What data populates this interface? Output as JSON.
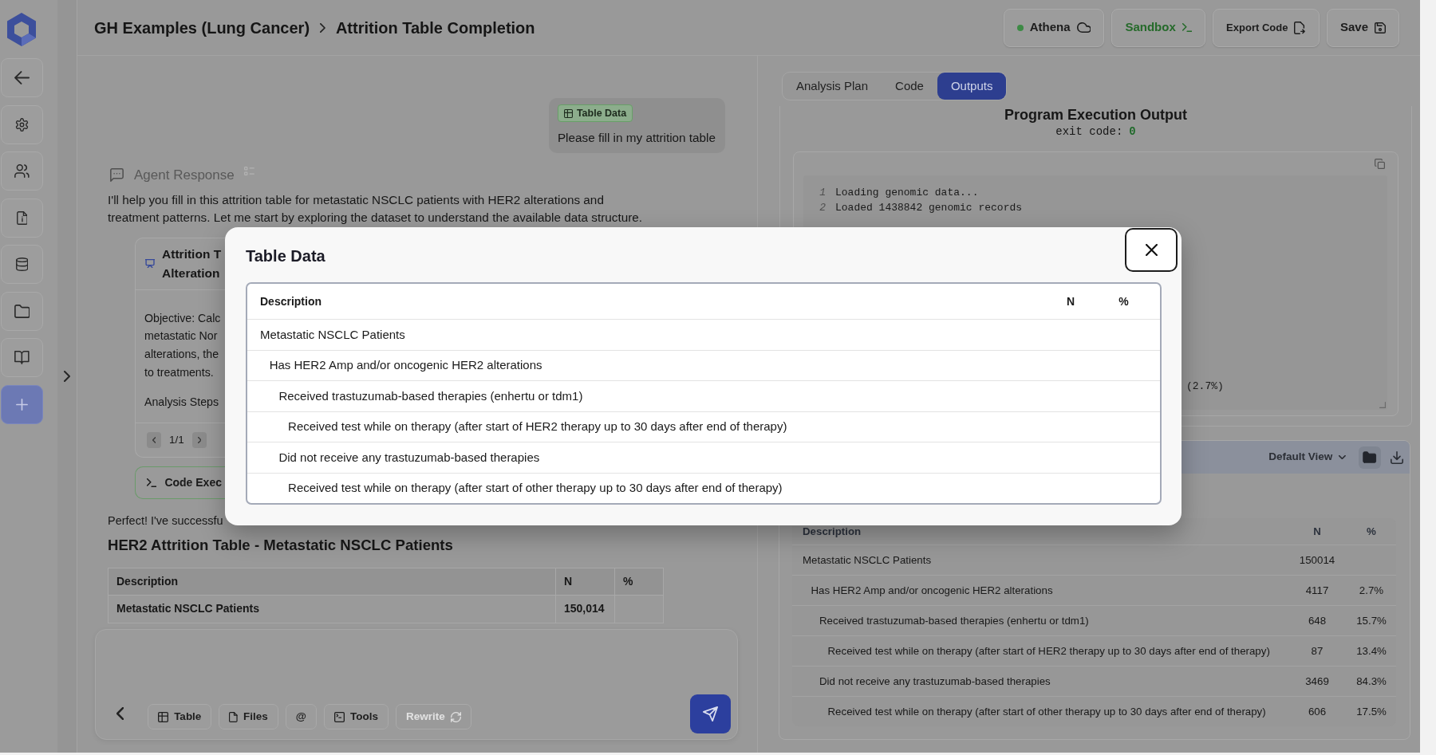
{
  "sidebar": {
    "items": [
      {
        "kind": "back"
      },
      {
        "kind": "settings"
      },
      {
        "kind": "users"
      },
      {
        "kind": "document"
      },
      {
        "kind": "database"
      },
      {
        "kind": "folder"
      },
      {
        "kind": "library"
      },
      {
        "kind": "new"
      }
    ]
  },
  "header": {
    "breadcrumb": [
      "GH Examples (Lung Cancer)",
      "Attrition Table Completion"
    ],
    "buttons": [
      {
        "kind": "environment",
        "label": "Athena"
      },
      {
        "kind": "sandbox",
        "label": "Sandbox"
      },
      {
        "kind": "export",
        "label": "Export Code"
      },
      {
        "kind": "save",
        "label": "Save"
      }
    ]
  },
  "chat": {
    "user_message": {
      "attachment": "Table Data",
      "text": "Please fill in my attrition table"
    },
    "agent_response": {
      "title": "Agent Response",
      "text": "I'll help you fill in this attrition table for metastatic NSCLC patients with HER2 alterations and treatment patterns. Let me start by exploring the dataset to understand the available data structure."
    },
    "plan_card": {
      "title_lines": [
        "Attrition T",
        "Alteration"
      ],
      "body_lines": [
        "Objective: Calc",
        "metastatic Nor",
        "alterations, the",
        "to treatments."
      ],
      "steps_label": "Analysis Steps",
      "pager": "1/1"
    },
    "code_card": {
      "title": "Code Exec"
    },
    "summary": "Perfect! I've successfu",
    "table_title": "HER2 Attrition Table - Metastatic NSCLC Patients",
    "table": {
      "columns": [
        "Description",
        "N",
        "%"
      ],
      "rows": [
        {
          "description": "Metastatic NSCLC Patients",
          "n": "150,014"
        }
      ]
    }
  },
  "composer": {
    "buttons": [
      {
        "kind": "back",
        "disabled": false
      },
      {
        "kind": "table",
        "label": "Table",
        "disabled": false
      },
      {
        "kind": "files",
        "label": "Files",
        "disabled": false
      },
      {
        "kind": "mention",
        "label": "@",
        "disabled": false
      },
      {
        "kind": "tools",
        "label": "Tools",
        "disabled": false
      },
      {
        "kind": "rewrite",
        "label": "Rewrite",
        "disabled": true
      }
    ]
  },
  "outputs": {
    "tabs": [
      {
        "label": "Analysis Plan",
        "selected": false
      },
      {
        "label": "Code",
        "selected": false
      },
      {
        "label": "Outputs",
        "selected": true
      }
    ],
    "title": "Program Execution Output",
    "exit_code_label": "exit code:",
    "exit_code": "0",
    "code_lines": [
      {
        "number": "1",
        "text": "Loading genomic data..."
      },
      {
        "number": "2",
        "text": "Loaded 1438842 genomic records"
      }
    ],
    "code_fragment": "(2.7%)",
    "table_view": {
      "view": "Default View",
      "columns": [
        "Description",
        "N",
        "%"
      ],
      "rows": [
        {
          "description": "Metastatic NSCLC Patients",
          "n": "150014",
          "children": [
            {
              "description": "Has HER2 Amp and/or oncogenic HER2 alterations",
              "n": "4117",
              "pct": "2.7%",
              "children": [
                {
                  "description": "Received trastuzumab-based therapies (enhertu or tdm1)",
                  "n": "648",
                  "pct": "15.7%",
                  "children": [
                    {
                      "description": "Received test while on therapy (after start of HER2 therapy up to 30 days after end of therapy)",
                      "n": "87",
                      "pct": "13.4%"
                    }
                  ]
                },
                {
                  "description": "Did not receive any trastuzumab-based therapies",
                  "n": "3469",
                  "pct": "84.3%",
                  "children": [
                    {
                      "description": "Received test while on therapy (after start of other therapy up to 30 days after end of therapy)",
                      "n": "606",
                      "pct": "17.5%"
                    }
                  ]
                }
              ]
            }
          ]
        }
      ]
    }
  },
  "dialog": {
    "title": "Table Data",
    "columns": [
      "Description",
      "N",
      "%"
    ],
    "rows": [
      {
        "description": "Metastatic NSCLC Patients",
        "children": [
          {
            "description": "Has HER2 Amp and/or oncogenic HER2 alterations",
            "children": [
              {
                "description": "Received trastuzumab-based therapies (enhertu or tdm1)",
                "children": [
                  {
                    "description": "Received test while on therapy (after start of HER2 therapy up to 30 days after end of therapy)"
                  }
                ]
              },
              {
                "description": "Did not receive any trastuzumab-based therapies",
                "children": [
                  {
                    "description": "Received test while on therapy (after start of other therapy up to 30 days after end of therapy)"
                  }
                ]
              }
            ]
          }
        ]
      }
    ]
  }
}
